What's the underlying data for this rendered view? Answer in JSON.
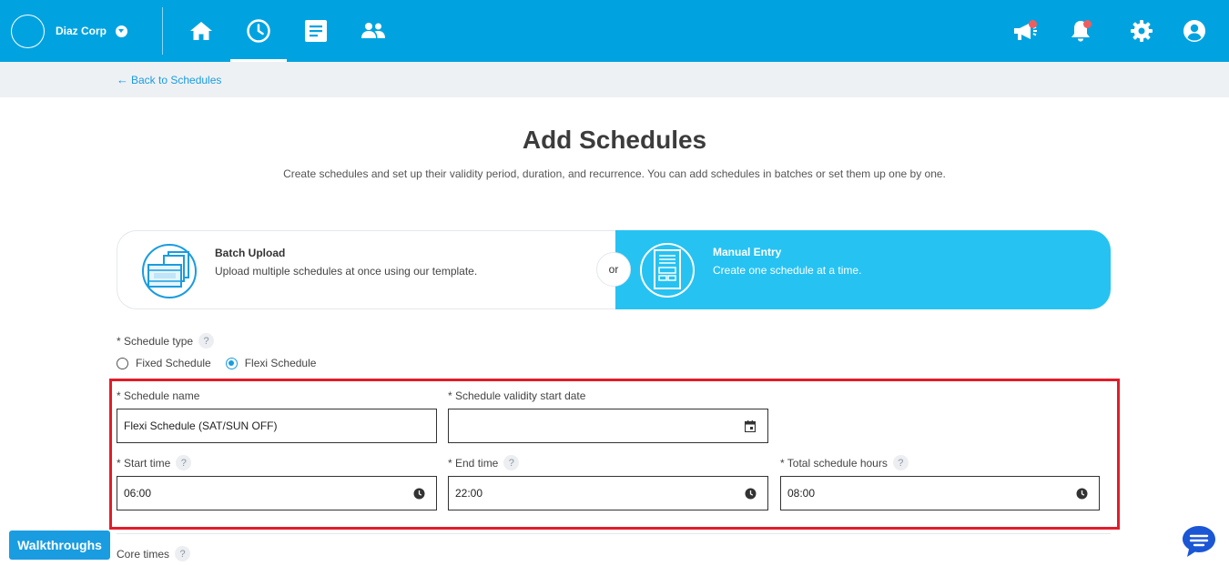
{
  "header": {
    "company_name": "Diaz Corp",
    "brand_color": "#00a3e0",
    "nav": [
      {
        "name": "home",
        "icon": "home-icon"
      },
      {
        "name": "schedules",
        "icon": "clock-icon",
        "active": true
      },
      {
        "name": "documents",
        "icon": "document-icon"
      },
      {
        "name": "people",
        "icon": "people-icon"
      }
    ],
    "right_icons": [
      "announcement-icon",
      "bell-icon",
      "gear-icon",
      "user-icon"
    ]
  },
  "breadcrumb": {
    "back_label": "Back to Schedules"
  },
  "page": {
    "title": "Add Schedules",
    "subtitle": "Create schedules and set up their validity period, duration, and recurrence. You can add schedules in batches or set them up one by one."
  },
  "modes": {
    "batch": {
      "title": "Batch Upload",
      "description": "Upload multiple schedules at once using our template."
    },
    "or_label": "or",
    "manual": {
      "title": "Manual Entry",
      "description": "Create one schedule at a time.",
      "selected": true,
      "color": "#26c2f2"
    }
  },
  "form": {
    "schedule_type_label": "* Schedule type",
    "schedule_type_options": [
      "Fixed Schedule",
      "Flexi Schedule"
    ],
    "schedule_type_selected": "Flexi Schedule",
    "schedule_name_label": "* Schedule name",
    "schedule_name_value": "Flexi Schedule (SAT/SUN OFF)",
    "validity_start_label": "* Schedule validity start date",
    "validity_start_value": "",
    "start_time_label": "* Start time",
    "start_time_value": "06:00",
    "end_time_label": "* End time",
    "end_time_value": "22:00",
    "total_hours_label": "* Total schedule hours",
    "total_hours_value": "08:00",
    "core_times_label": "Core times",
    "help_glyph": "?"
  },
  "footer": {
    "walkthroughs_label": "Walkthroughs"
  }
}
